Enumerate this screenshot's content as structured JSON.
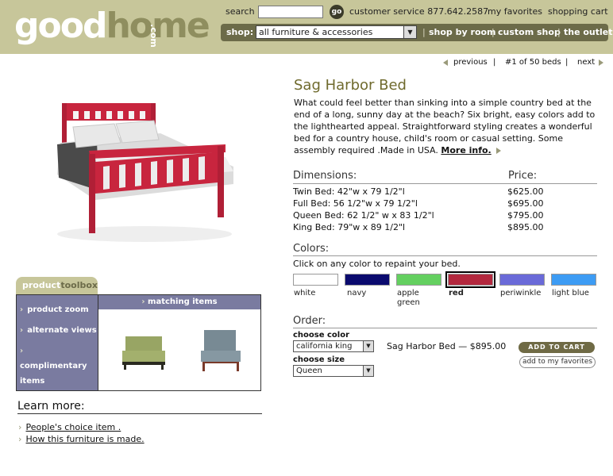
{
  "header": {
    "logo": {
      "good": "good",
      "home": "home",
      "com": ".com"
    },
    "search_label": "search",
    "search_value": "",
    "go_label": "go",
    "customer_service": "customer service 877.642.2587",
    "my_favorites": "my favorites",
    "shopping_cart": "shopping cart",
    "shop_label": "shop:",
    "shop_select_value": "all furniture & accessories",
    "nav": [
      "shop by room",
      "custom shop",
      "the outlet"
    ]
  },
  "pager": {
    "previous": "previous",
    "position": "#1 of 50 beds",
    "next": "next"
  },
  "product": {
    "title": "Sag Harbor Bed",
    "description": "What could feel better than sinking into a simple country bed at the end of a long, sunny day at the beach? Six bright, easy colors add to the lighthearted appeal. Straightforward styling creates a wonderful bed for a country house, child's room or casual setting. Some assembly required .Made in USA.",
    "more_info": "More info.",
    "bed_color": "#c8253e"
  },
  "dimensions": {
    "heading": "Dimensions:",
    "price_heading": "Price:",
    "rows": [
      {
        "size": "Twin Bed: 42\"w x 79 1/2\"l",
        "price": "$625.00"
      },
      {
        "size": "Full Bed: 56 1/2\"w x 79 1/2\"l",
        "price": "$695.00"
      },
      {
        "size": "Queen Bed: 62 1/2\" w x 83 1/2\"l",
        "price": "$795.00"
      },
      {
        "size": "King Bed: 79\"w x 89 1/2\"l",
        "price": "$895.00"
      }
    ]
  },
  "colors": {
    "heading": "Colors:",
    "instruction": "Click on any color to repaint your bed.",
    "swatches": [
      {
        "name": "white",
        "hex": "#ffffff"
      },
      {
        "name": "navy",
        "hex": "#0a0a6e"
      },
      {
        "name": "apple green",
        "hex": "#64d060"
      },
      {
        "name": "red",
        "hex": "#b3283e"
      },
      {
        "name": "periwinkle",
        "hex": "#6a6ad8"
      },
      {
        "name": "light blue",
        "hex": "#3d9cf4"
      }
    ],
    "selected": "red"
  },
  "order": {
    "heading": "Order:",
    "choose_color_label": "choose color",
    "choose_color_value": "california king",
    "choose_size_label": "choose size",
    "choose_size_value": "Queen",
    "summary": "Sag Harbor Bed — $895.00",
    "add_to_cart": "ADD TO CART",
    "add_to_favorites": "add to my favorites"
  },
  "toolbox": {
    "tab_product": "product",
    "tab_toolbox": "toolbox",
    "items": [
      "product zoom",
      "alternate  views",
      "complimentary items"
    ],
    "matching_heading": "matching items"
  },
  "learn_more": {
    "heading": "Learn more:",
    "links": [
      "People's choice item .",
      "How this furniture is made."
    ]
  }
}
